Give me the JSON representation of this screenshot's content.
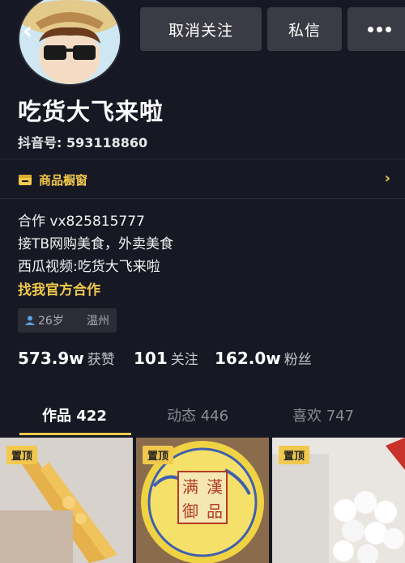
{
  "header": {
    "unfollow_label": "取消关注",
    "message_label": "私信"
  },
  "profile": {
    "name": "吃货大飞来啦",
    "douyin_id": "抖音号: 593118860",
    "shop_label": "商品橱窗",
    "bio": {
      "line1": "合作 vx825815777",
      "line2": "接TB网购美食，外卖美食",
      "line3": "西瓜视频:吃货大飞来啦",
      "link": "找我官方合作"
    },
    "tags": {
      "age": "26岁",
      "city": "温州"
    }
  },
  "stats": {
    "likes": {
      "value": "573.9w",
      "label": "获赞"
    },
    "following": {
      "value": "101",
      "label": "关注"
    },
    "followers": {
      "value": "162.0w",
      "label": "粉丝"
    }
  },
  "tabs": [
    {
      "label": "作品 422"
    },
    {
      "label": "动态 446"
    },
    {
      "label": "喜欢 747"
    }
  ],
  "thumbnails": [
    {
      "badge": "置顶"
    },
    {
      "badge": "置顶",
      "box_text": [
        "满",
        "漢",
        "御",
        "品"
      ]
    },
    {
      "badge": "置顶"
    }
  ],
  "colors": {
    "background": "#161823",
    "accent": "#f2c94c",
    "button": "#3a3b44"
  }
}
